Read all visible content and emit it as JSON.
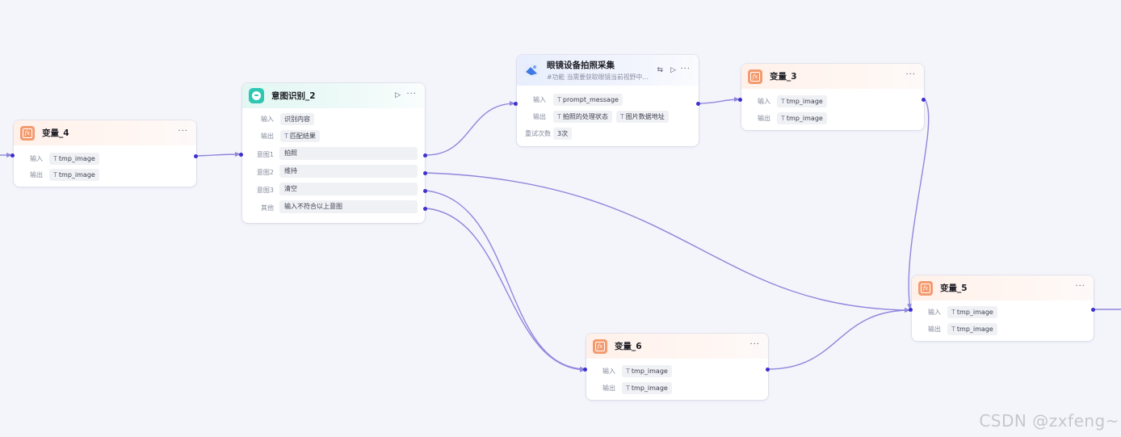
{
  "nodes": {
    "var4": {
      "title": "变量_4",
      "input_label": "输入",
      "input_value": "tmp_image",
      "output_label": "输出",
      "output_value": "tmp_image",
      "type_icon": "T"
    },
    "intent2": {
      "title": "意图识别_2",
      "input_label": "输入",
      "input_value": "识别内容",
      "output_label": "输出",
      "output_value": "匹配结果",
      "type_icon": "T",
      "intents": [
        {
          "label": "意图1",
          "value": "拍照"
        },
        {
          "label": "意图2",
          "value": "维持"
        },
        {
          "label": "意图3",
          "value": "清空"
        },
        {
          "label": "其他",
          "value": "输入不符合以上意图"
        }
      ]
    },
    "plugin": {
      "title": "眼镜设备拍照采集",
      "subtitle": "#功能 当需要获取眼镜当前视野中...",
      "input_label": "输入",
      "input_value": "prompt_message",
      "output_label": "输出",
      "output_values": [
        "拍照的处理状态",
        "图片数据地址"
      ],
      "retry_label": "重试次数",
      "retry_value": "3次",
      "type_icon": "T"
    },
    "var3": {
      "title": "变量_3",
      "input_label": "输入",
      "input_value": "tmp_image",
      "output_label": "输出",
      "output_value": "tmp_image",
      "type_icon": "T"
    },
    "var5": {
      "title": "变量_5",
      "input_label": "输入",
      "input_value": "tmp_image",
      "output_label": "输出",
      "output_value": "tmp_image",
      "type_icon": "T"
    },
    "var6": {
      "title": "变量_6",
      "input_label": "输入",
      "input_value": "tmp_image",
      "output_label": "输出",
      "output_value": "tmp_image",
      "type_icon": "T"
    }
  },
  "icons": {
    "variable": "fx-variable-icon",
    "intent": "intent-recognition-icon",
    "plugin": "glasses-plugin-icon",
    "more": "more-options-icon",
    "run": "play-icon",
    "swap": "swap-icon"
  },
  "glyphs": {
    "more": "···",
    "run": "▷",
    "swap": "⇆",
    "fx": "fx"
  },
  "colors": {
    "canvas": "#f4f4fb",
    "edge": "#8f87dc",
    "port": "#3d2fd0",
    "variable_accent": "#f39a6e",
    "intent_accent": "#2ec7b4"
  },
  "watermark": "CSDN @zxfeng~"
}
